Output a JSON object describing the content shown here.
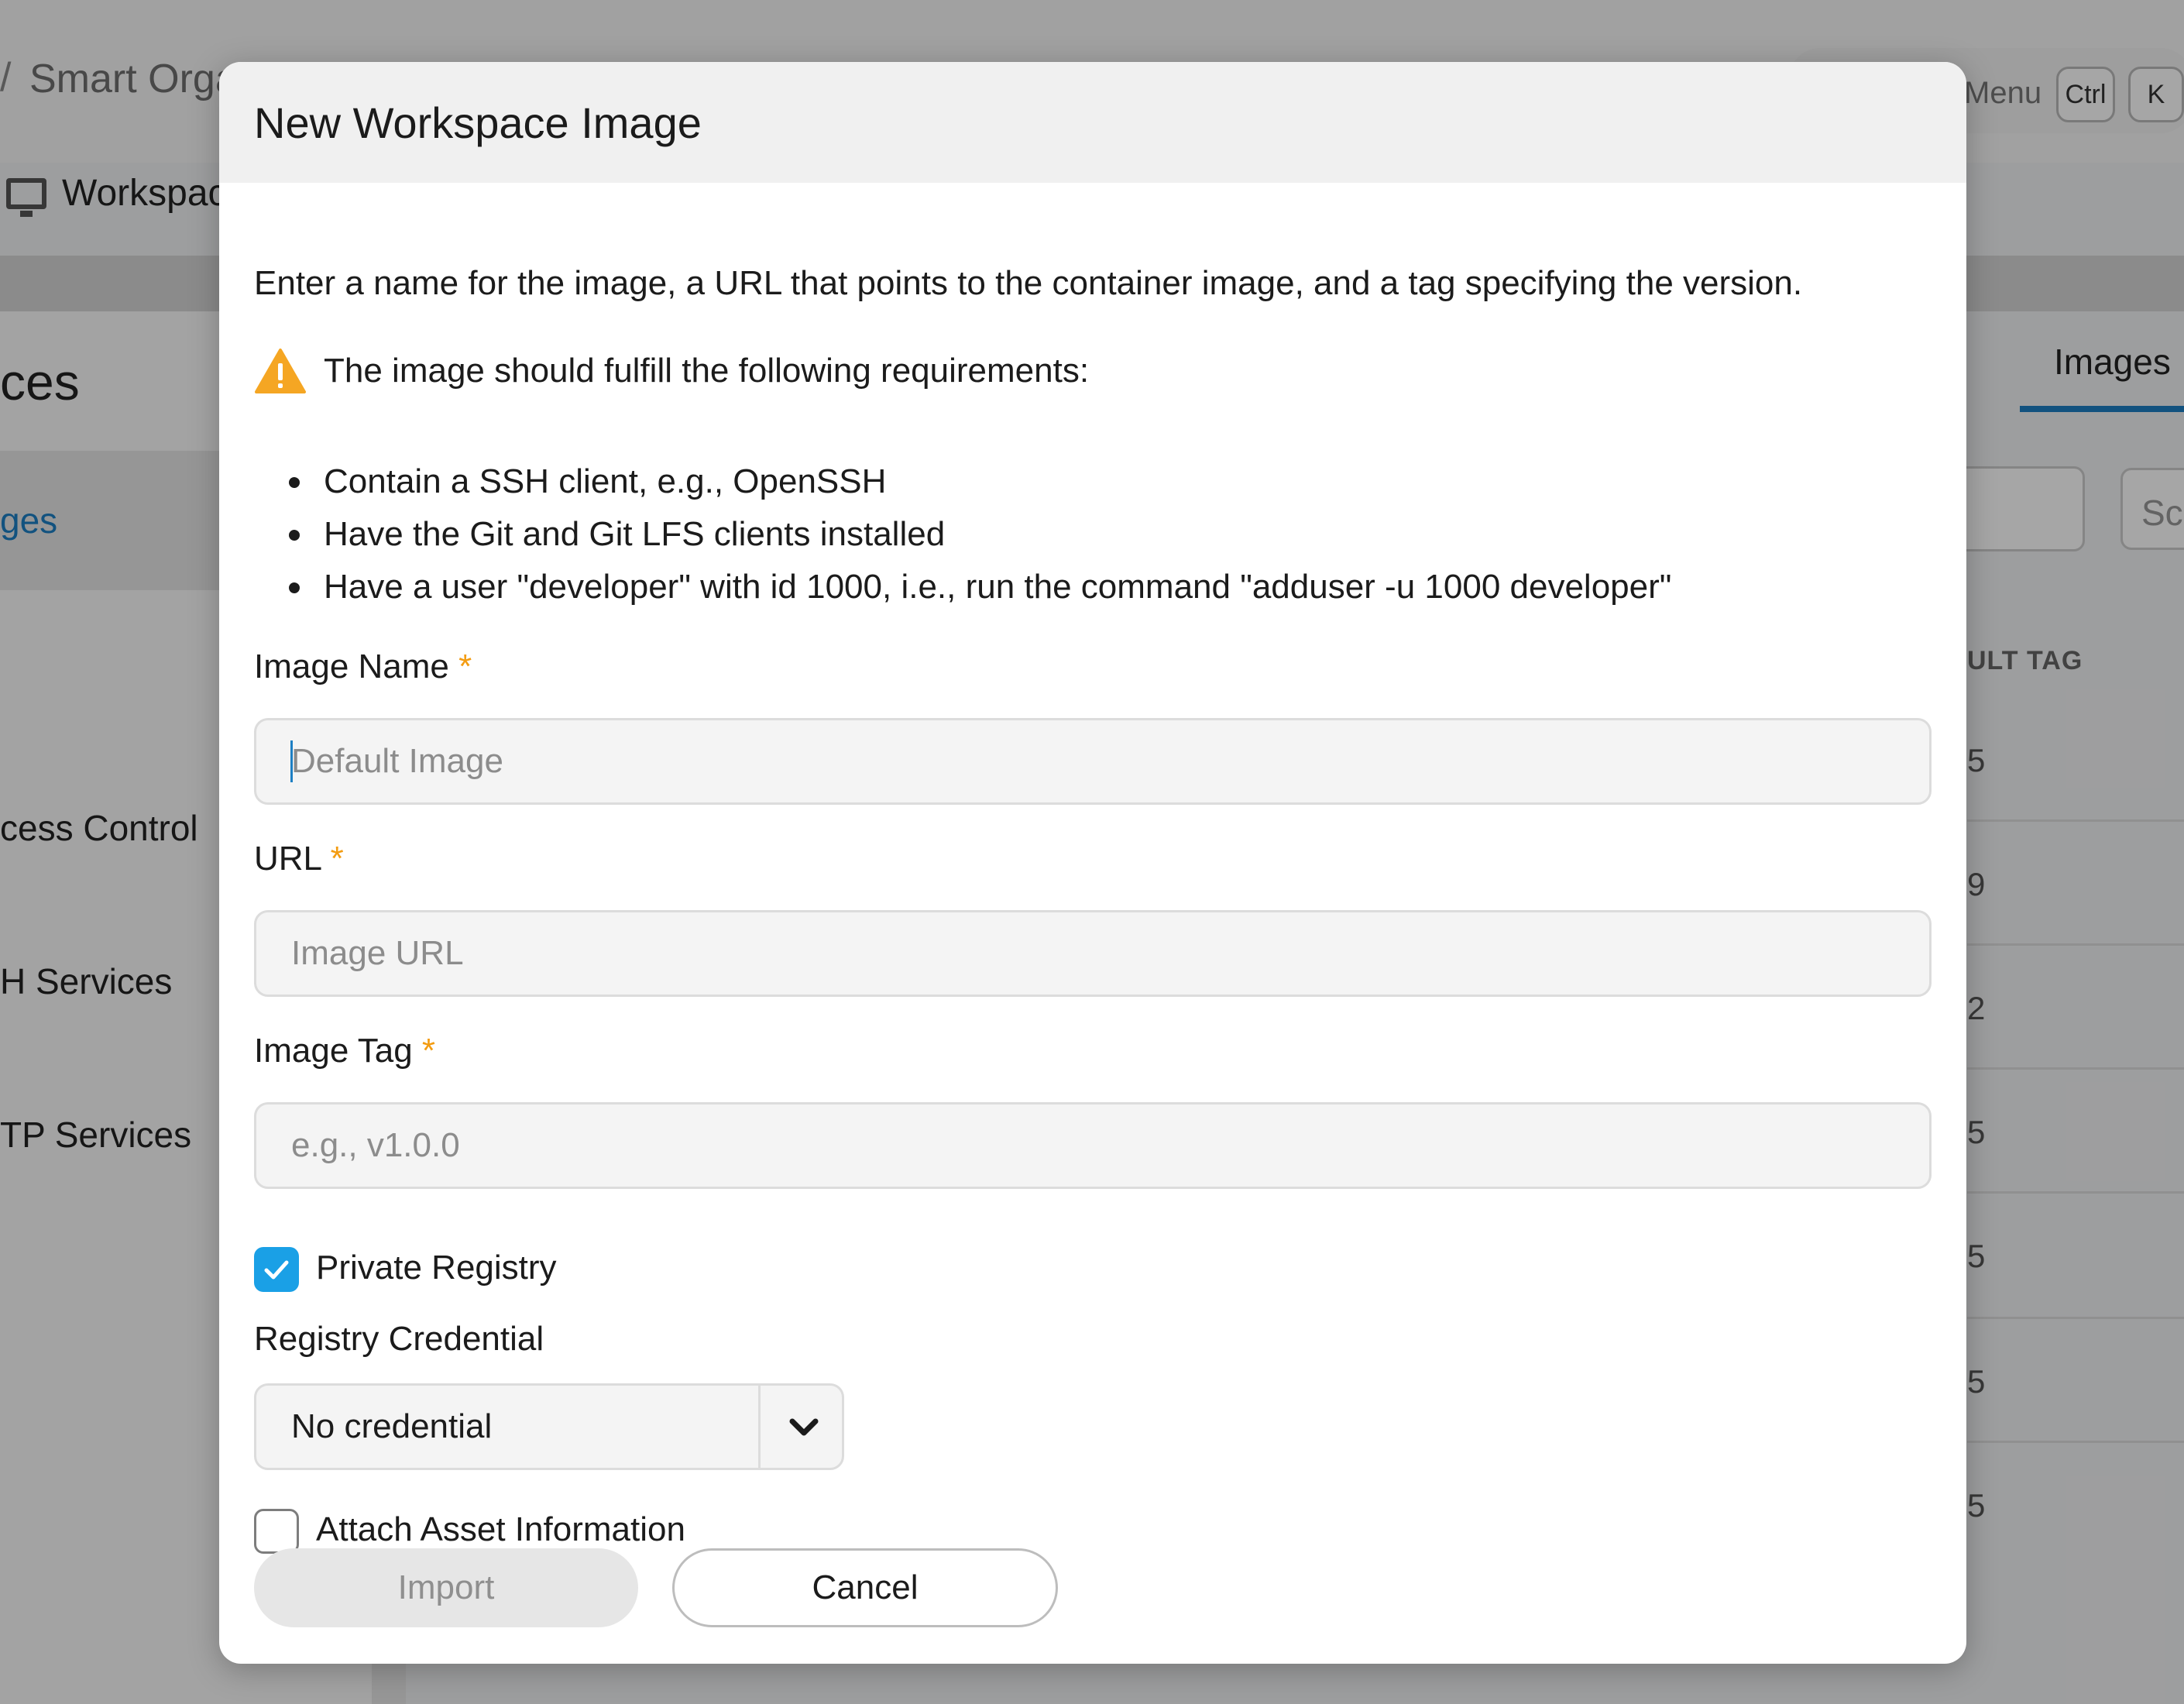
{
  "background": {
    "breadcrumb_sep": "/",
    "org_name": "Smart Orga",
    "workspace_label": "Workspac",
    "sidebar_title": "ces",
    "sidebar_selected": "ges",
    "sidebar_items": [
      "cess Control",
      "H Services",
      "TP Services"
    ],
    "menu_label": "Menu",
    "shortcut_keys": [
      "Ctrl",
      "K"
    ],
    "tab_label": "Images",
    "search_placeholder": "Sc",
    "column_header": "ULT TAG",
    "row_values": [
      "5",
      "9",
      "2",
      "5",
      "5",
      "5",
      "5"
    ]
  },
  "dialog": {
    "title": "New Workspace Image",
    "description": "Enter a name for the image, a URL that points to the container image, and a tag specifying the version.",
    "warning": "The image should fulfill the following requirements:",
    "requirements": [
      "Contain a SSH client, e.g., OpenSSH",
      "Have the Git and Git LFS clients installed",
      "Have a user \"developer\" with id 1000, i.e., run the command \"adduser -u 1000 developer\""
    ],
    "required_mark": "*",
    "fields": {
      "name": {
        "label": "Image Name",
        "value": "",
        "placeholder": "Default Image"
      },
      "url": {
        "label": "URL",
        "value": "",
        "placeholder": "Image URL"
      },
      "tag": {
        "label": "Image Tag",
        "value": "",
        "placeholder": "e.g., v1.0.0"
      }
    },
    "private_registry": {
      "label": "Private Registry",
      "checked": true
    },
    "registry_credential": {
      "label": "Registry Credential",
      "selected": "No credential"
    },
    "attach_asset": {
      "label": "Attach Asset Information",
      "checked": false
    },
    "buttons": {
      "import": "Import",
      "cancel": "Cancel"
    },
    "colors": {
      "accent": "#1aa0e6",
      "required": "#f39c12",
      "warning": "#f5a623"
    }
  }
}
